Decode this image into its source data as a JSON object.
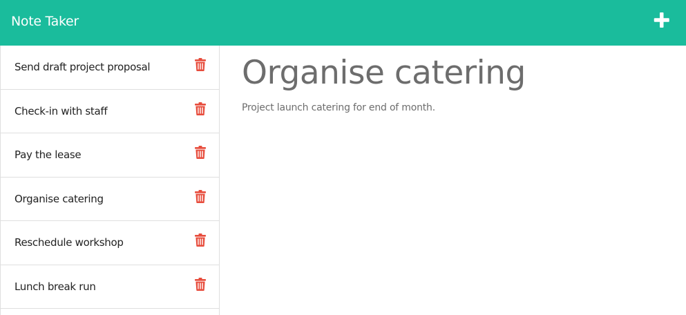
{
  "app": {
    "title": "Note Taker",
    "accent_color": "#1abc9c",
    "new_note_icon": "plus-icon"
  },
  "notes": [
    {
      "title": "Send draft project proposal",
      "delete_icon": "trash-icon"
    },
    {
      "title": "Check-in with staff",
      "delete_icon": "trash-icon"
    },
    {
      "title": "Pay the lease",
      "delete_icon": "trash-icon"
    },
    {
      "title": "Organise catering",
      "delete_icon": "trash-icon"
    },
    {
      "title": "Reschedule workshop",
      "delete_icon": "trash-icon"
    },
    {
      "title": "Lunch break run",
      "delete_icon": "trash-icon"
    }
  ],
  "active_note": {
    "title": "Organise catering",
    "text": "Project launch catering for end of month."
  },
  "colors": {
    "delete": "#e74c3c",
    "text": "#222222",
    "muted": "#6d6d6d",
    "border": "#dfdfdf"
  }
}
